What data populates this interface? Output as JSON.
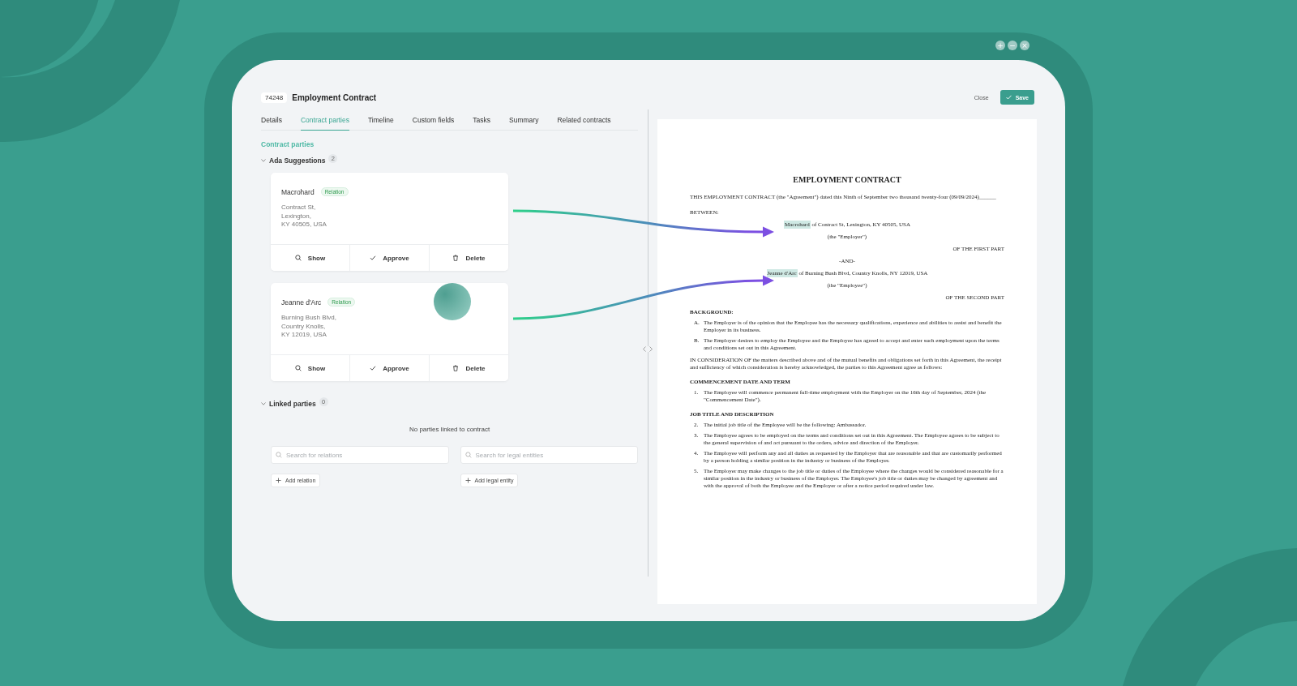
{
  "window": {
    "controls": [
      "+",
      "−",
      "×"
    ]
  },
  "header": {
    "id": "74248",
    "title": "Employment Contract",
    "close": "Close",
    "save": "Save"
  },
  "tabs": [
    {
      "label": "Details",
      "selected": false
    },
    {
      "label": "Contract parties",
      "selected": true
    },
    {
      "label": "Timeline",
      "selected": false
    },
    {
      "label": "Custom fields",
      "selected": false
    },
    {
      "label": "Tasks",
      "selected": false
    },
    {
      "label": "Summary",
      "selected": false
    },
    {
      "label": "Related contracts",
      "selected": false
    }
  ],
  "section_title": "Contract parties",
  "suggestions": {
    "label": "Ada Suggestions",
    "count": "2",
    "expanded": true,
    "items": [
      {
        "name": "Macrohard",
        "tag": "Relation",
        "address": [
          "Contract St,",
          "Lexington,",
          "KY 40505, USA"
        ],
        "actions": [
          "Show",
          "Approve",
          "Delete"
        ]
      },
      {
        "name": "Jeanne d'Arc",
        "tag": "Relation",
        "address": [
          "Burning Bush Blvd,",
          "Country Knolls,",
          "KY 12019, USA"
        ],
        "actions": [
          "Show",
          "Approve",
          "Delete"
        ]
      }
    ]
  },
  "linked": {
    "label": "Linked parties",
    "count": "0",
    "expanded": true,
    "empty": "No parties linked to contract",
    "searches": [
      {
        "placeholder": "Search for relations",
        "add": "Add relation"
      },
      {
        "placeholder": "Search for legal entities",
        "add": "Add legal entity"
      }
    ]
  },
  "document": {
    "title": "EMPLOYMENT CONTRACT",
    "intro": "THIS EMPLOYMENT CONTRACT (the \"Agreement\") dated this Ninth of September two thousand twenty-four (09/09/2024)______",
    "between": "BETWEEN:",
    "parties": [
      {
        "name": "Macrohard",
        "rest": " of Contract St, Lexington, KY 40505, USA",
        "role": "(the \"Employer\")",
        "part": "OF THE FIRST PART"
      },
      {
        "name": "Jeanne d'Arc",
        "rest": " of Burning Bush Blvd, Country Knolls, NY 12019, USA",
        "role": "(the \"Employee\")",
        "part": "OF THE SECOND PART"
      }
    ],
    "and": "-AND-",
    "blocks": [
      {
        "kind": "heading",
        "text": "BACKGROUND:"
      },
      {
        "kind": "item",
        "marker": "A.",
        "text": "The Employer is of the opinion that the Employee has the necessary qualifications, experience and abilities to assist and benefit the Employer in its business."
      },
      {
        "kind": "item",
        "marker": "B.",
        "text": "The Employer desires to employ the Employee and the Employee has agreed to accept and enter such employment upon the terms and conditions set out in this Agreement."
      },
      {
        "kind": "para",
        "text": "IN CONSIDERATION OF the matters described above and of the mutual benefits and obligations set forth in this Agreement, the receipt and sufficiency of which consideration is hereby acknowledged, the parties to this Agreement agree as follows:"
      },
      {
        "kind": "heading",
        "text": "COMMENCEMENT DATE AND TERM"
      },
      {
        "kind": "item",
        "marker": "1.",
        "text": "The Employee will commence permanent full-time employment with the Employer on the 16th day of September, 2024 (the \"Commencement Date\")."
      },
      {
        "kind": "heading",
        "text": "JOB TITLE AND DESCRIPTION"
      },
      {
        "kind": "item",
        "marker": "2.",
        "text": "The initial job title of the Employee will be the following: Ambassador."
      },
      {
        "kind": "item",
        "marker": "3.",
        "text": "The Employee agrees to be employed on the terms and conditions set out in this Agreement. The Employee agrees to be subject to the general supervision of and act pursuant to the orders, advice and direction of the Employer."
      },
      {
        "kind": "item",
        "marker": "4.",
        "text": "The Employee will perform any and all duties as requested by the Employer that are reasonable and that are customarily performed by a person holding a similar position in the industry or business of the Employer."
      },
      {
        "kind": "item",
        "marker": "5.",
        "text": "The Employer may make changes to the job title or duties of the Employee where the changes would be considered reasonable for a similar position in the industry or business of the Employer. The Employee's job title or duties may be changed by agreement and with the approval of both the Employee and the Employer or after a notice period required under law."
      }
    ]
  }
}
